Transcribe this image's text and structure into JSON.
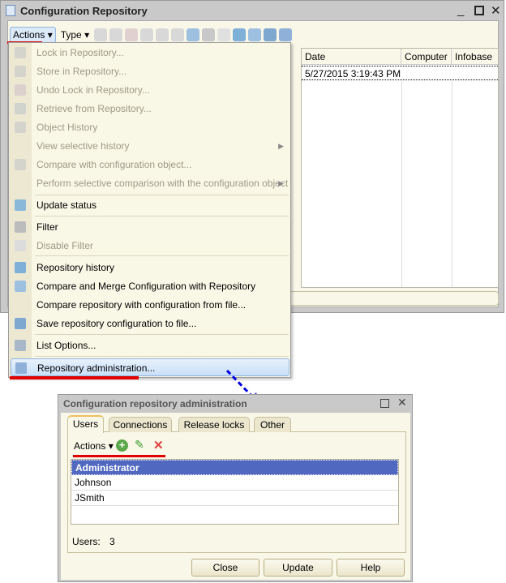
{
  "main_window": {
    "title": "Configuration Repository",
    "toolbar": {
      "actions": "Actions",
      "type": "Type"
    },
    "columns": [
      "Date",
      "Computer",
      "Infobase"
    ],
    "row": {
      "date": "5/27/2015 3:19:43 PM",
      "computer": "",
      "infobase": ""
    }
  },
  "actions_menu": {
    "items": [
      {
        "label": "Lock in Repository...",
        "disabled": true
      },
      {
        "label": "Store in Repository...",
        "disabled": true
      },
      {
        "label": "Undo Lock in Repository...",
        "disabled": true
      },
      {
        "label": "Retrieve from Repository...",
        "disabled": true
      },
      {
        "label": "Object History",
        "disabled": true
      },
      {
        "label": "View selective history",
        "disabled": true
      },
      {
        "label": "Compare with configuration object...",
        "disabled": true
      },
      {
        "label": "Perform selective comparison with the configuration object",
        "disabled": true
      },
      {
        "label": "Update status",
        "disabled": false
      },
      {
        "label": "Filter",
        "disabled": false
      },
      {
        "label": "Disable Filter",
        "disabled": true
      },
      {
        "label": "Repository history",
        "disabled": false
      },
      {
        "label": "Compare and Merge Configuration with Repository",
        "disabled": false
      },
      {
        "label": "Compare repository with configuration from file...",
        "disabled": false
      },
      {
        "label": "Save repository configuration to file...",
        "disabled": false
      },
      {
        "label": "List Options...",
        "disabled": false
      },
      {
        "label": "Repository administration...",
        "disabled": false,
        "highlighted": true
      }
    ]
  },
  "admin_dialog": {
    "title": "Configuration repository administration",
    "tabs": [
      "Users",
      "Connections",
      "Release locks",
      "Other"
    ],
    "active_tab": "Users",
    "actions": "Actions",
    "users": [
      "Administrator",
      "Johnson",
      "JSmith"
    ],
    "selected_user": "Administrator",
    "users_label": "Users:",
    "users_count": "3",
    "buttons": {
      "close": "Close",
      "update": "Update",
      "help": "Help"
    }
  },
  "colors": {
    "highlight_underline": "#e00000",
    "arrow": "#0000e0",
    "selection": "#5068c0"
  }
}
